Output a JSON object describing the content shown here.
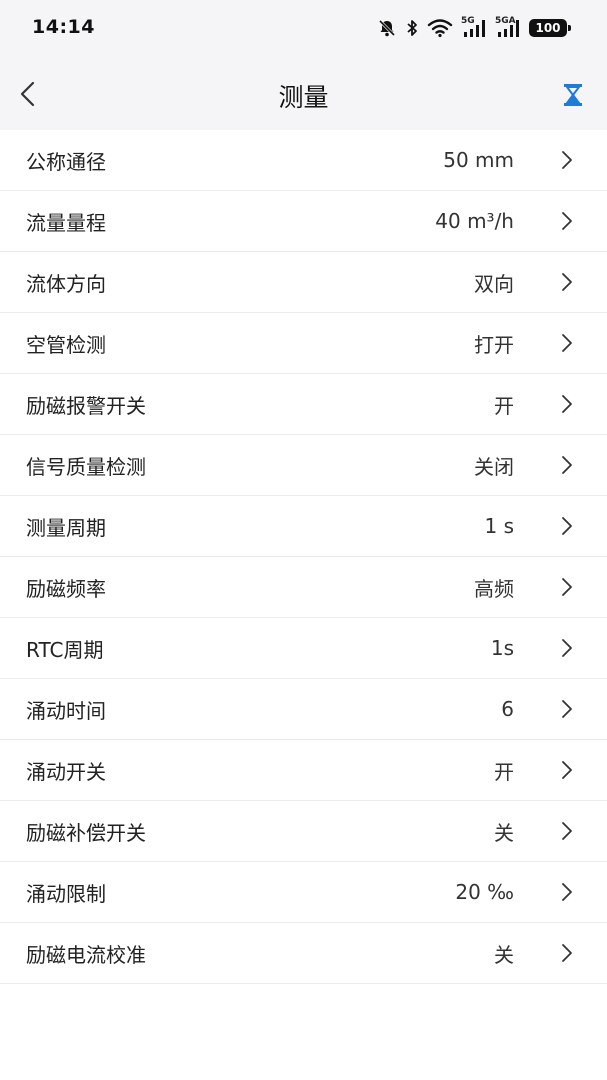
{
  "status_bar": {
    "time": "14:14",
    "signal_1_label": "5G",
    "signal_2_label": "5GA",
    "battery": "100"
  },
  "header": {
    "title": "测量",
    "accent_color": "#1e7bd6"
  },
  "items": [
    {
      "label": "公称通径",
      "value": "50 mm"
    },
    {
      "label": "流量量程",
      "value": "40 m³/h"
    },
    {
      "label": "流体方向",
      "value": "双向"
    },
    {
      "label": "空管检测",
      "value": "打开"
    },
    {
      "label": "励磁报警开关",
      "value": "开"
    },
    {
      "label": "信号质量检测",
      "value": "关闭"
    },
    {
      "label": "测量周期",
      "value": "1 s"
    },
    {
      "label": "励磁频率",
      "value": "高频"
    },
    {
      "label": "RTC周期",
      "value": "1s"
    },
    {
      "label": "涌动时间",
      "value": "6"
    },
    {
      "label": "涌动开关",
      "value": "开"
    },
    {
      "label": "励磁补偿开关",
      "value": "关"
    },
    {
      "label": "涌动限制",
      "value": "20 ‰"
    },
    {
      "label": "励磁电流校准",
      "value": "关"
    }
  ]
}
